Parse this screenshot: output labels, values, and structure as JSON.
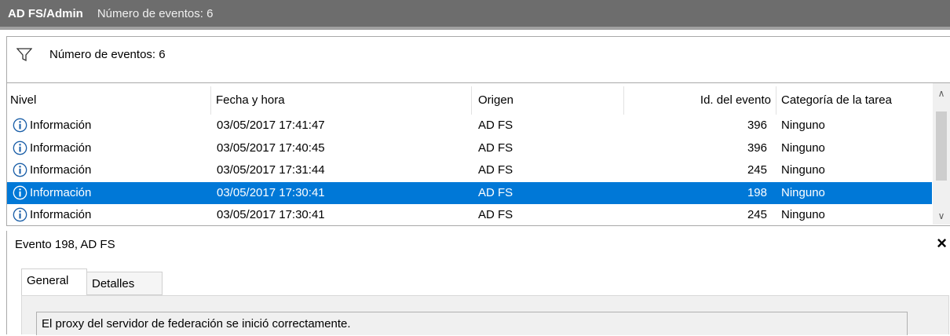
{
  "title_bar": {
    "log_name": "AD FS/Admin",
    "event_count": "Número de eventos: 6"
  },
  "filter_bar": {
    "icon": "filter-icon",
    "text": "Número de eventos: 6"
  },
  "columns": [
    "Nivel",
    "Fecha y hora",
    "Origen",
    "Id. del evento",
    "Categoría de la tarea"
  ],
  "events": [
    {
      "level": "Información",
      "datetime": "03/05/2017 17:41:47",
      "source": "AD FS",
      "event_id": "396",
      "category": "Ninguno",
      "selected": false
    },
    {
      "level": "Información",
      "datetime": "03/05/2017 17:40:45",
      "source": "AD FS",
      "event_id": "396",
      "category": "Ninguno",
      "selected": false
    },
    {
      "level": "Información",
      "datetime": "03/05/2017 17:31:44",
      "source": "AD FS",
      "event_id": "245",
      "category": "Ninguno",
      "selected": false
    },
    {
      "level": "Información",
      "datetime": "03/05/2017 17:30:41",
      "source": "AD FS",
      "event_id": "198",
      "category": "Ninguno",
      "selected": true
    },
    {
      "level": "Información",
      "datetime": "03/05/2017 17:30:41",
      "source": "AD FS",
      "event_id": "245",
      "category": "Ninguno",
      "selected": false
    }
  ],
  "detail": {
    "title": "Evento 198, AD FS",
    "close_symbol": "×",
    "tabs": [
      "General",
      "Detalles"
    ],
    "active_tab": "General",
    "message": "El proxy del servidor de federación se inició correctamente."
  },
  "colors": {
    "selection": "#0078d7",
    "title_bar": "#6d6d6d",
    "info_icon": "#1b5fa8"
  }
}
